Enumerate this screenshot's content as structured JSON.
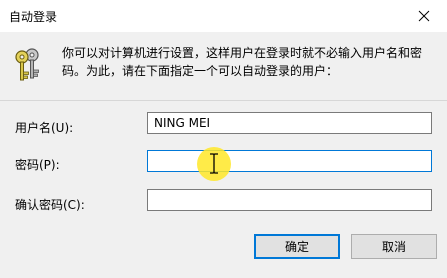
{
  "window": {
    "title": "自动登录",
    "close_icon": "close-icon"
  },
  "description": {
    "icon": "keys-icon",
    "text": "你可以对计算机进行设置，这样用户在登录时就不必输入用户名和密码。为此，请在下面指定一个可以自动登录的用户："
  },
  "form": {
    "username_label": "用户名(U):",
    "username_value": "NING MEI",
    "password_label": "密码(P):",
    "password_value": "",
    "confirm_label": "确认密码(C):",
    "confirm_value": ""
  },
  "buttons": {
    "ok_label": "确定",
    "cancel_label": "取消"
  },
  "pointer": {
    "icon": "text-cursor-icon",
    "highlight_color": "#ffe828"
  },
  "colors": {
    "accent": "#0078d7",
    "dialog_bg": "#f0f0f0"
  }
}
